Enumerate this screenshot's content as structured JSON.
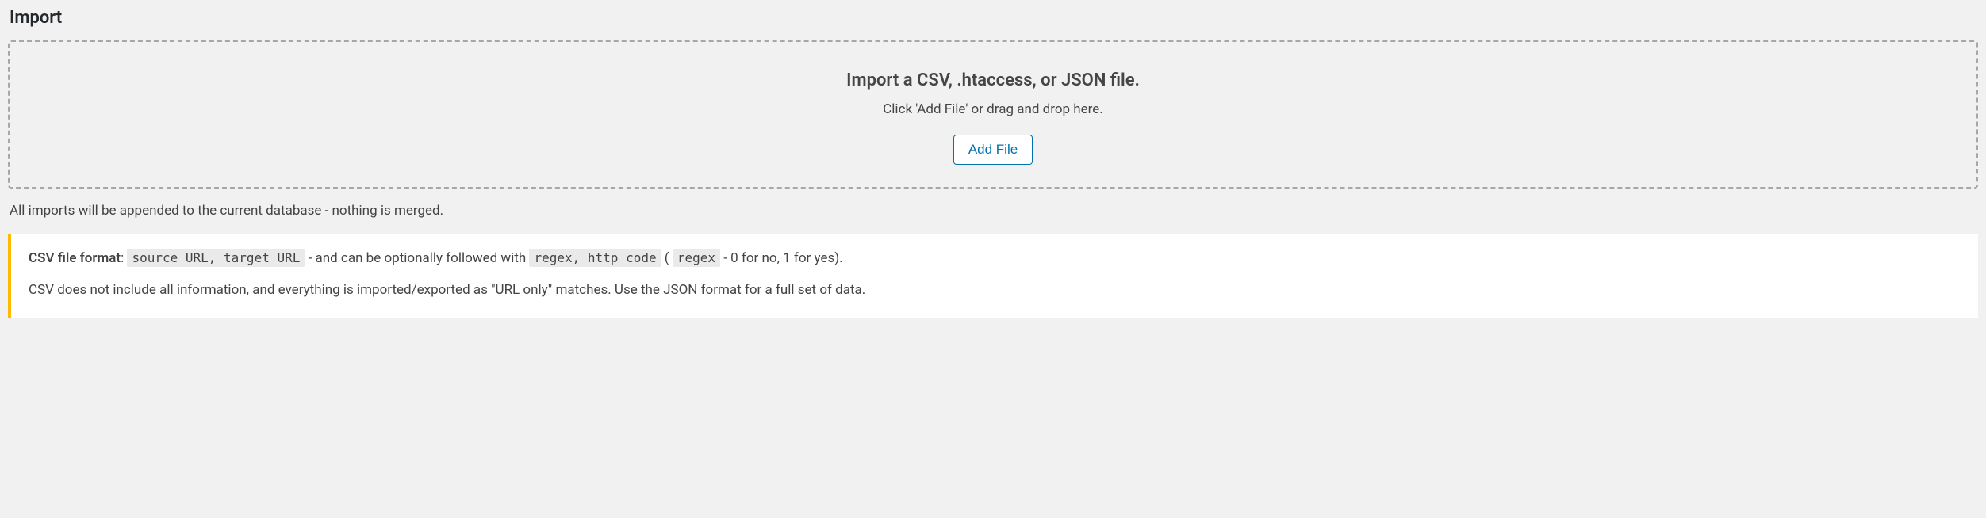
{
  "page": {
    "title": "Import"
  },
  "dropzone": {
    "heading": "Import a CSV, .htaccess, or JSON file.",
    "instruction": "Click 'Add File' or drag and drop here.",
    "button_label": "Add File"
  },
  "append_note": "All imports will be appended to the current database - nothing is merged.",
  "notice": {
    "format_label": "CSV file format",
    "colon": ": ",
    "code1": "source URL, target URL",
    "after_code1": " - and can be optionally followed with ",
    "code2": "regex, http code",
    "paren_open": " ( ",
    "code3": "regex",
    "paren_close": " - 0 for no, 1 for yes).",
    "full_text_line2": "CSV does not include all information, and everything is imported/exported as \"URL only\" matches. Use the JSON format for a full set of data."
  }
}
